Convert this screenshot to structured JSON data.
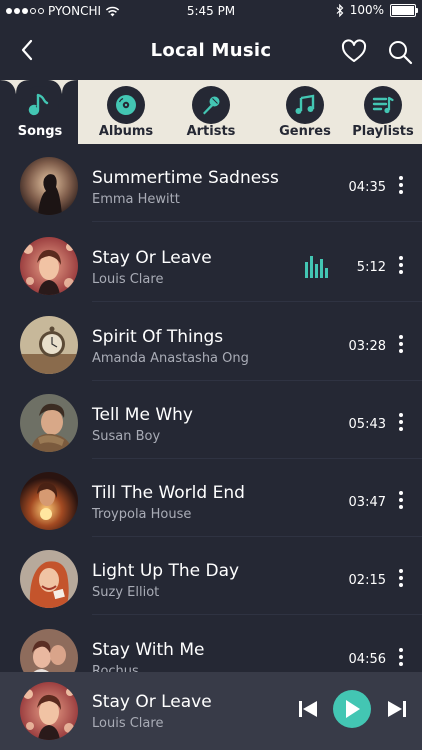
{
  "status_bar": {
    "carrier": "PYONCHI",
    "time": "5:45 PM",
    "battery": "100%",
    "signal_dots_filled": 3,
    "signal_dots_total": 5
  },
  "header": {
    "title": "Local Music",
    "icons": [
      "back-arrow-icon",
      "heart-icon",
      "search-icon"
    ]
  },
  "tabs": [
    {
      "label": "Songs",
      "icon": "music-note-icon",
      "active": true
    },
    {
      "label": "Albums",
      "icon": "vinyl-disc-icon",
      "active": false
    },
    {
      "label": "Artists",
      "icon": "microphone-icon",
      "active": false
    },
    {
      "label": "Genres",
      "icon": "double-music-note-icon",
      "active": false
    },
    {
      "label": "Playlists",
      "icon": "playlist-icon",
      "active": false
    }
  ],
  "songs": [
    {
      "title": "Summertime Sadness",
      "artist": "Emma Hewitt",
      "duration": "04:35",
      "playing": false
    },
    {
      "title": "Stay Or Leave",
      "artist": "Louis Clare",
      "duration": "5:12",
      "playing": true
    },
    {
      "title": "Spirit Of Things",
      "artist": "Amanda Anastasha Ong",
      "duration": "03:28",
      "playing": false
    },
    {
      "title": "Tell Me Why",
      "artist": "Susan Boy",
      "duration": "05:43",
      "playing": false
    },
    {
      "title": "Till The World End",
      "artist": "Troypola House",
      "duration": "03:47",
      "playing": false
    },
    {
      "title": "Light Up The Day",
      "artist": "Suzy Elliot",
      "duration": "02:15",
      "playing": false
    },
    {
      "title": "Stay With Me",
      "artist": "Rochus",
      "duration": "04:56",
      "playing": false
    }
  ],
  "now_playing": {
    "title": "Stay Or Leave",
    "artist": "Louis Clare"
  },
  "colors": {
    "background": "#252834",
    "accent": "#43c6b3",
    "tab_bar": "#ece8dd",
    "player_bar": "#383b48"
  }
}
